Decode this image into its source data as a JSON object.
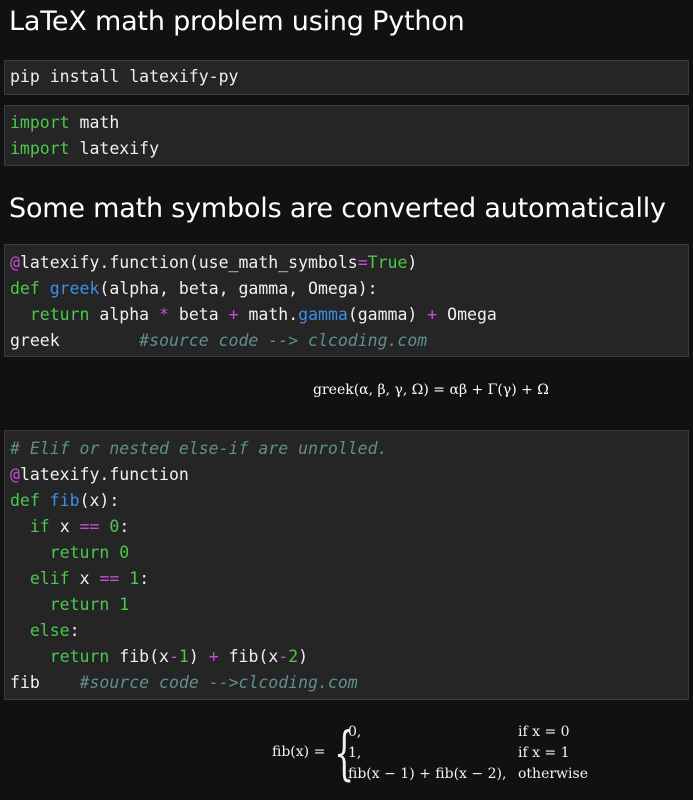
{
  "heading1": "LaTeX math problem using Python",
  "heading2": "Some math symbols are converted automatically",
  "pip_cmd": "pip install latexify-py",
  "imports": {
    "kw": "import",
    "mod1": "math",
    "mod2": "latexify"
  },
  "greek_code": {
    "at": "@",
    "decorator": "latexify.function(use_math_symbols",
    "eq": "=",
    "true_kw": "True",
    "close": ")",
    "def_kw": "def",
    "fname": "greek",
    "params": "(alpha, beta, gamma, Omega):",
    "ret_kw": "return",
    "ret_a": "alpha",
    "mul": "*",
    "ret_b": "beta",
    "plus1": "+",
    "ret_c": "math.",
    "gamma_fn": "gamma",
    "ret_d": "(gamma)",
    "plus2": "+",
    "ret_e": "Omega",
    "call": "greek",
    "comment": "#source code --> clcoding.com"
  },
  "greek_output": "greek(α, β, γ, Ω) = αβ + Γ(γ) + Ω",
  "fib_code": {
    "comment1": "# Elif or nested else-if are unrolled.",
    "at": "@",
    "decorator": "latexify.function",
    "def_kw": "def",
    "fname": "fib",
    "params": "(x):",
    "if_kw": "if",
    "if_var": "x",
    "eqeq1": "==",
    "zero": "0",
    "colon1": ":",
    "ret_kw1": "return",
    "ret0": "0",
    "elif_kw": "elif",
    "elif_var": "x",
    "eqeq2": "==",
    "one": "1",
    "colon2": ":",
    "ret_kw2": "return",
    "ret1": "1",
    "else_kw": "else",
    "colon3": ":",
    "ret_kw3": "return",
    "call_a": "fib(x",
    "minus1": "-",
    "n1": "1",
    "call_b": ")",
    "plus": "+",
    "call_c": "fib(x",
    "minus2": "-",
    "n2": "2",
    "call_d": ")",
    "call": "fib",
    "comment2": "#source code -->clcoding.com"
  },
  "fib_output": {
    "lhs": "fib(x) =",
    "row1": "0,",
    "cond1": "if x = 0",
    "row2": "1,",
    "cond2": "if x = 1",
    "row3": "fib(x − 1) + fib(x − 2),",
    "cond3": "otherwise"
  },
  "colors": {
    "keyword": "#4cc94c",
    "function": "#3d8fe6",
    "operator": "#c84fd8",
    "comment": "#5f8f8f",
    "background": "#111111",
    "code_bg": "#252525"
  }
}
